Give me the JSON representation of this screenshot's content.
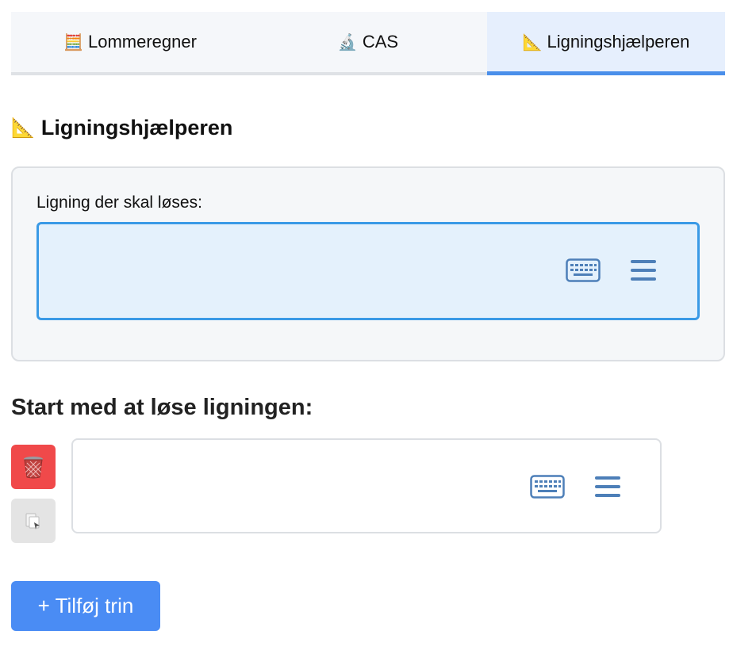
{
  "tabs": [
    {
      "label": "Lommeregner",
      "icon": "abacus-icon",
      "glyph": "🧮"
    },
    {
      "label": "CAS",
      "icon": "microscope-icon",
      "glyph": "🔬"
    },
    {
      "label": "Ligningshjælperen",
      "icon": "triangular-ruler-icon",
      "glyph": "📐",
      "active": true
    }
  ],
  "page": {
    "title": "Ligningshjælperen",
    "title_glyph": "📐"
  },
  "equation": {
    "label": "Ligning der skal løses:",
    "value": ""
  },
  "steps": {
    "heading": "Start med at løse ligningen:",
    "items": [
      {
        "value": ""
      }
    ]
  },
  "actions": {
    "add_step_label": "+ Tilføj trin"
  },
  "colors": {
    "accent": "#4a8fea",
    "input_focus_border": "#3a9ae6",
    "delete_button": "#f0494a",
    "add_button": "#4a8cf4",
    "icon_color": "#4d7fb8"
  }
}
